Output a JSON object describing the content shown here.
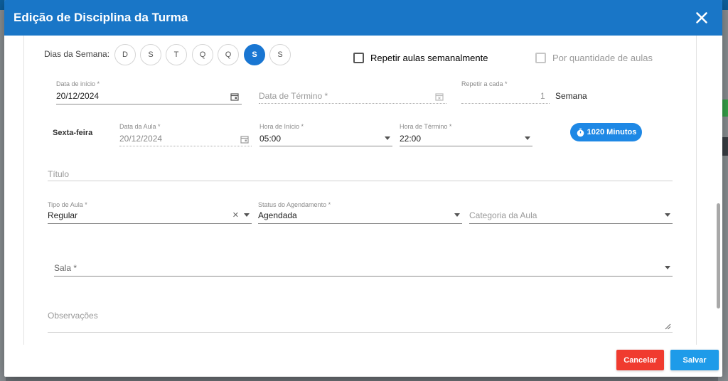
{
  "dialog": {
    "title": "Edição de Disciplina da Turma"
  },
  "days": {
    "label": "Dias da Semana:",
    "items": [
      "D",
      "S",
      "T",
      "Q",
      "Q",
      "S",
      "S"
    ],
    "active_index": 5
  },
  "options": {
    "repeat_weekly": "Repetir aulas semanalmente",
    "by_quantity": "Por quantidade de aulas"
  },
  "dates": {
    "start_label": "Data de início *",
    "start_value": "20/12/2024",
    "end_placeholder": "Data de Término *",
    "repeat_label": "Repetir a cada *",
    "repeat_value": "1",
    "repeat_unit": "Semana"
  },
  "session": {
    "day_name": "Sexta-feira",
    "class_date_label": "Data da Aula *",
    "class_date_value": "20/12/2024",
    "start_time_label": "Hora de Início *",
    "start_time_value": "05:00",
    "end_time_label": "Hora de Término *",
    "end_time_value": "22:00",
    "duration": "1020 Minutos"
  },
  "details": {
    "title_placeholder": "Título",
    "class_type_label": "Tipo de Aula *",
    "class_type_value": "Regular",
    "schedule_status_label": "Status do Agendamento *",
    "schedule_status_value": "Agendada",
    "category_placeholder": "Categoria da Aula",
    "room_placeholder": "Sala *",
    "notes_placeholder": "Observações"
  },
  "actions": {
    "cancel": "Cancelar",
    "save": "Salvar"
  },
  "colors": {
    "header": "#1976c7",
    "cancel": "#f03b2f",
    "save": "#1e9be9",
    "active_day": "#1976d2"
  }
}
